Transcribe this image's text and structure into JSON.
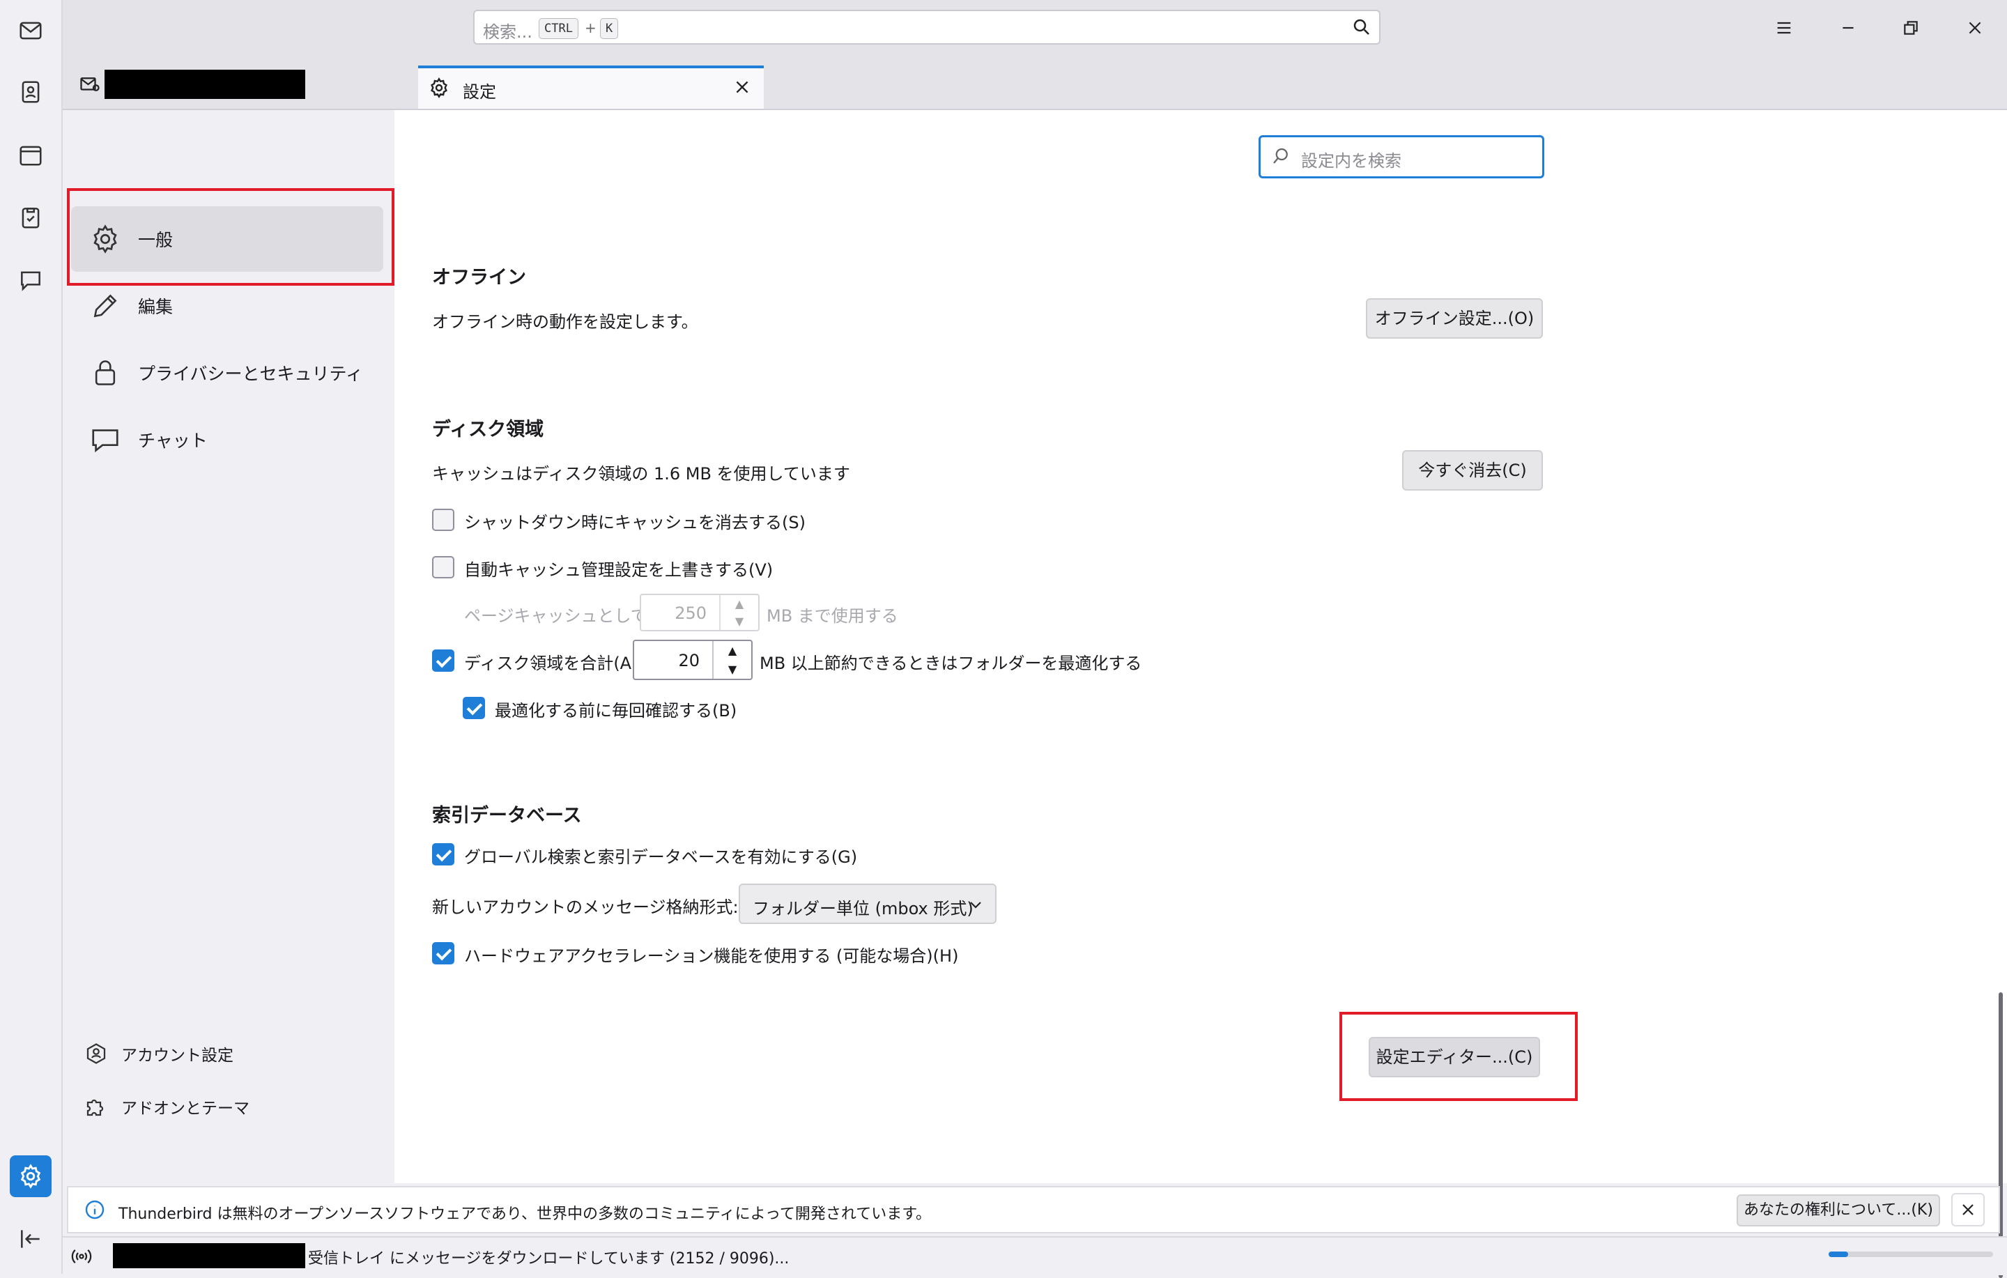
{
  "app": {
    "search_placeholder": "検索...",
    "shortcut_ctrl": "CTRL",
    "shortcut_plus": "+",
    "shortcut_k": "K"
  },
  "tab": {
    "label": "設定"
  },
  "settings_search": {
    "placeholder": "設定内を検索"
  },
  "nav": {
    "items": [
      {
        "label": "一般"
      },
      {
        "label": "編集"
      },
      {
        "label": "プライバシーとセキュリティ"
      },
      {
        "label": "チャット"
      }
    ],
    "bottom": [
      {
        "label": "アカウント設定"
      },
      {
        "label": "アドオンとテーマ"
      }
    ]
  },
  "offline": {
    "heading": "オフライン",
    "desc": "オフライン時の動作を設定します。",
    "button": "オフライン設定...(O)"
  },
  "disk": {
    "heading": "ディスク領域",
    "cache_text": "キャッシュはディスク領域の 1.6 MB を使用しています",
    "clear_button": "今すぐ消去(C)",
    "clear_on_shutdown": "シャットダウン時にキャッシュを消去する(S)",
    "override_cache": "自動キャッシュ管理設定を上書きする(V)",
    "page_cache_label": "ページキャッシュとして(U)",
    "page_cache_value": "250",
    "page_cache_unit": "MB まで使用する",
    "compact_label": "ディスク領域を合計(A)",
    "compact_value": "20",
    "compact_unit": "MB 以上節約できるときはフォルダーを最適化する",
    "confirm_compact": "最適化する前に毎回確認する(B)"
  },
  "index": {
    "heading": "索引データベース",
    "global_search": "グローバル検索と索引データベースを有効にする(G)",
    "store_label": "新しいアカウントのメッセージ格納形式:(T)",
    "store_value": "フォルダー単位 (mbox 形式)",
    "hw_accel": "ハードウェアアクセラレーション機能を使用する (可能な場合)(H)"
  },
  "config_editor": {
    "button": "設定エディター...(C)"
  },
  "notification": {
    "text": "Thunderbird は無料のオープンソースソフトウェアであり、世界中の多数のコミュニティによって開発されています。",
    "button": "あなたの権利について...(K)"
  },
  "status": {
    "text": "受信トレイ にメッセージをダウンロードしています (2152 / 9096)..."
  },
  "checked": {
    "clear_on_shutdown": false,
    "override_cache": false,
    "compact": true,
    "confirm_compact": true,
    "global_search": true,
    "hw_accel": true
  },
  "colors": {
    "accent": "#1f7fd8",
    "highlight_box": "#e11b27"
  }
}
